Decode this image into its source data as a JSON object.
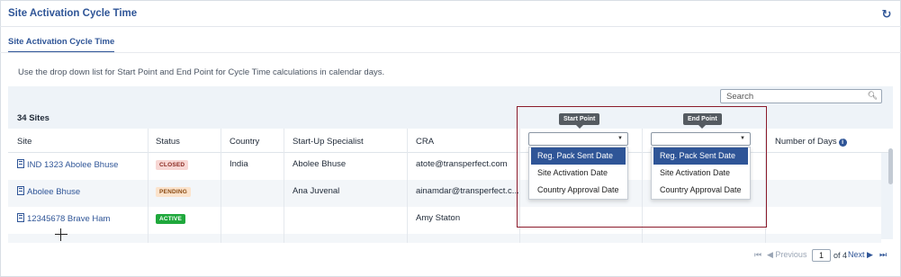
{
  "header": {
    "title": "Site Activation Cycle Time",
    "refresh_icon": "refresh-icon"
  },
  "tabs": [
    {
      "label": "Site Activation Cycle Time",
      "active": true
    }
  ],
  "instructions": "Use the drop down list for Start Point and End Point for Cycle Time calculations in calendar days.",
  "search": {
    "placeholder": "Search",
    "value": ""
  },
  "table": {
    "count_label": "34 Sites",
    "columns": [
      "Site",
      "Status",
      "Country",
      "Start-Up Specialist",
      "CRA",
      "",
      "",
      "Number of Days"
    ],
    "rows": [
      {
        "site": "IND 1323 Abolee Bhuse",
        "status": "CLOSED",
        "country": "India",
        "specialist": "Abolee Bhuse",
        "cra": "atote@transperfect.com"
      },
      {
        "site": "Abolee Bhuse",
        "status": "PENDING",
        "country": "",
        "specialist": "Ana Juvenal",
        "cra": "ainamdar@transperfect.c..."
      },
      {
        "site": "12345678 Brave Ham",
        "status": "ACTIVE",
        "country": "",
        "specialist": "",
        "cra": "Amy Staton"
      }
    ]
  },
  "start_point": {
    "tooltip": "Start Point",
    "value": "",
    "options": [
      "Reg. Pack Sent Date",
      "Site Activation Date",
      "Country Approval Date"
    ],
    "highlighted": "Reg. Pack Sent Date"
  },
  "end_point": {
    "tooltip": "End Point",
    "value": "",
    "options": [
      "Reg. Pack Sent Date",
      "Site Activation Date",
      "Country Approval Date"
    ],
    "highlighted": "Reg. Pack Sent Date"
  },
  "pagination": {
    "previous": "Previous",
    "next": "Next",
    "page": "1",
    "of_label": "of 4"
  },
  "colors": {
    "accent": "#2f5597",
    "highlight_border": "#8b1a2b",
    "active": "#1fa83c"
  }
}
